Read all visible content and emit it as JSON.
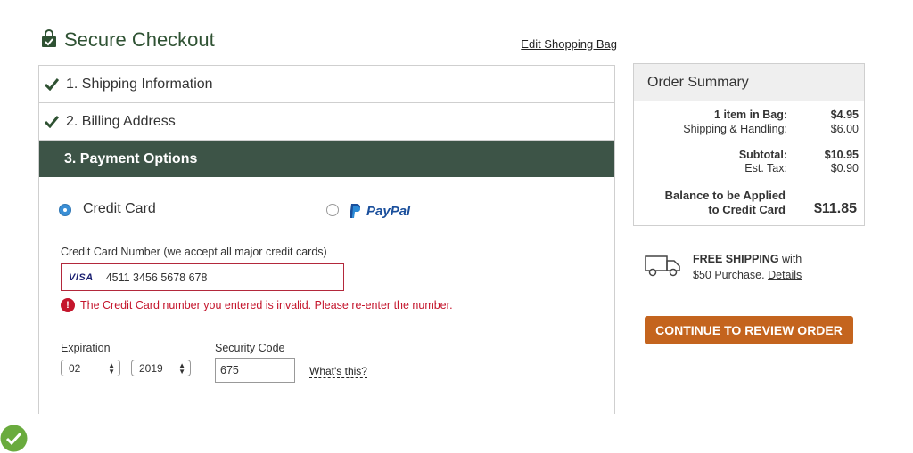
{
  "header": {
    "title": "Secure Checkout",
    "edit_bag_link": "Edit Shopping Bag"
  },
  "steps": [
    {
      "label": "1. Shipping Information",
      "status": "complete"
    },
    {
      "label": "2. Billing Address",
      "status": "complete"
    },
    {
      "label": "3. Payment Options",
      "status": "active"
    }
  ],
  "payment": {
    "options": [
      {
        "label": "Credit Card",
        "selected": true
      },
      {
        "label": "PayPal",
        "selected": false
      }
    ],
    "card_number_label": "Credit Card Number (we accept all major credit cards)",
    "card_brand": "VISA",
    "card_number_value": "4511 3456 5678 678",
    "error_icon": "!",
    "error_message": "The Credit Card number you entered is invalid. Please re-enter the number.",
    "expiration_label": "Expiration",
    "expiration_month": "02",
    "expiration_year": "2019",
    "security_code_label": "Security Code",
    "security_code_value": "675",
    "whats_this_link": "What's this?"
  },
  "order_summary": {
    "title": "Order Summary",
    "items_label": "1 item in Bag:",
    "items_value": "$4.95",
    "shipping_label": "Shipping & Handling:",
    "shipping_value": "$6.00",
    "subtotal_label": "Subtotal:",
    "subtotal_value": "$10.95",
    "tax_label": "Est. Tax:",
    "tax_value": "$0.90",
    "balance_label_line1": "Balance to be Applied",
    "balance_label_line2": "to Credit Card",
    "balance_value": "$11.85"
  },
  "shipping_promo": {
    "strong": "FREE SHIPPING",
    "rest_line1": " with",
    "line2": "$50 Purchase.",
    "details_link": "Details"
  },
  "continue_button": "CONTINUE TO REVIEW ORDER",
  "colors": {
    "brand_green": "#3d5447",
    "title_green": "#2f5233",
    "error_red": "#c4152c",
    "cta_orange": "#c4641e",
    "radio_blue": "#3a8fd6",
    "ok_badge_green": "#6aab3e"
  },
  "icons": [
    "lock-bag-icon",
    "check-icon",
    "radio-icon",
    "paypal-logo-icon",
    "visa-logo-icon",
    "error-icon",
    "select-arrows-icon",
    "truck-icon",
    "check-circle-icon"
  ]
}
